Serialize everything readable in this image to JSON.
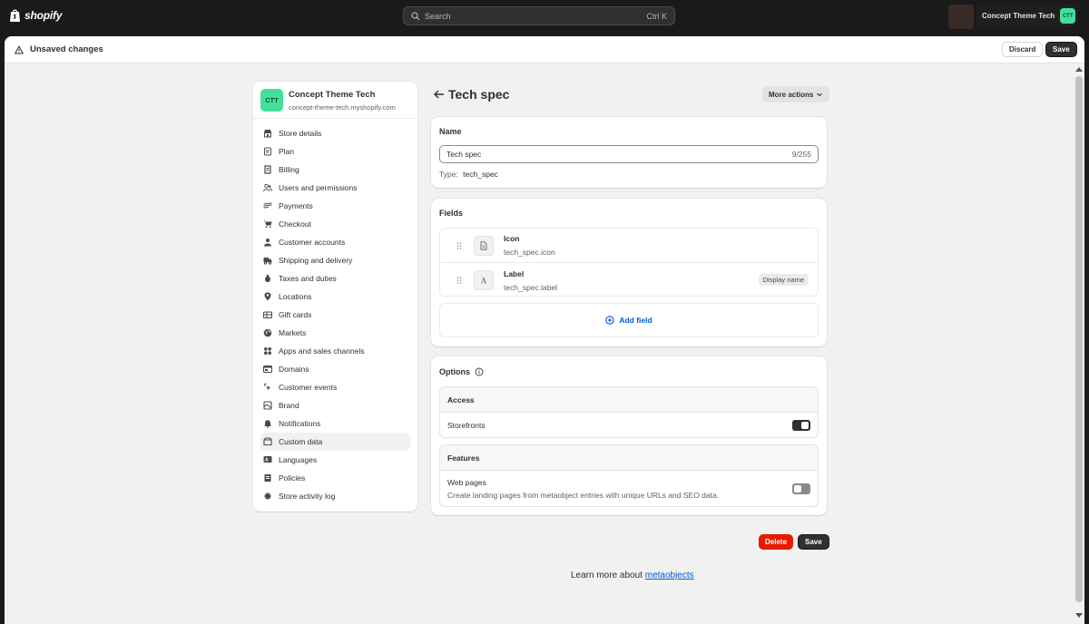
{
  "topbar": {
    "brand": "shopify",
    "search_placeholder": "Search",
    "search_shortcut": "Ctrl K",
    "store_name": "Concept Theme Tech",
    "store_initials": "CTT"
  },
  "save_bar": {
    "message": "Unsaved changes",
    "discard_label": "Discard",
    "save_label": "Save"
  },
  "settings_nav": {
    "store_name": "Concept Theme Tech",
    "store_domain": "concept-theme-tech.myshopify.com",
    "store_initials": "CTT",
    "items": [
      {
        "label": "Store details",
        "icon": "store-icon"
      },
      {
        "label": "Plan",
        "icon": "plan-icon"
      },
      {
        "label": "Billing",
        "icon": "billing-icon"
      },
      {
        "label": "Users and permissions",
        "icon": "users-icon"
      },
      {
        "label": "Payments",
        "icon": "payments-icon"
      },
      {
        "label": "Checkout",
        "icon": "cart-icon"
      },
      {
        "label": "Customer accounts",
        "icon": "person-icon"
      },
      {
        "label": "Shipping and delivery",
        "icon": "truck-icon"
      },
      {
        "label": "Taxes and duties",
        "icon": "tax-icon"
      },
      {
        "label": "Locations",
        "icon": "location-icon"
      },
      {
        "label": "Gift cards",
        "icon": "gift-card-icon"
      },
      {
        "label": "Markets",
        "icon": "globe-icon"
      },
      {
        "label": "Apps and sales channels",
        "icon": "apps-icon"
      },
      {
        "label": "Domains",
        "icon": "domain-icon"
      },
      {
        "label": "Customer events",
        "icon": "cursor-icon"
      },
      {
        "label": "Brand",
        "icon": "brand-icon"
      },
      {
        "label": "Notifications",
        "icon": "bell-icon"
      },
      {
        "label": "Custom data",
        "icon": "custom-data-icon",
        "active": true
      },
      {
        "label": "Languages",
        "icon": "language-icon"
      },
      {
        "label": "Policies",
        "icon": "policy-icon"
      },
      {
        "label": "Store activity log",
        "icon": "activity-icon"
      }
    ]
  },
  "page": {
    "title": "Tech spec",
    "more_actions_label": "More actions"
  },
  "name_card": {
    "title": "Name",
    "value": "Tech spec",
    "char_count": "9/255",
    "type_label": "Type:",
    "type_value": "tech_spec"
  },
  "fields_card": {
    "title": "Fields",
    "fields": [
      {
        "name": "Icon",
        "key": "tech_spec.icon",
        "icon": "file-icon",
        "badge": ""
      },
      {
        "name": "Label",
        "key": "tech_spec.label",
        "icon": "text-icon",
        "badge": "Display name"
      }
    ],
    "add_label": "Add field"
  },
  "options_card": {
    "title": "Options",
    "access": {
      "heading": "Access",
      "row_label": "Storefronts",
      "enabled": true
    },
    "features": {
      "heading": "Features",
      "row_label": "Web pages",
      "row_desc": "Create landing pages from metaobject entries with unique URLs and SEO data.",
      "enabled": false
    }
  },
  "footer": {
    "delete_label": "Delete",
    "save_label": "Save",
    "learn_text": "Learn more about",
    "learn_link": "metaobjects"
  },
  "colors": {
    "accent_green": "#44e09a",
    "link_blue": "#005bd3",
    "danger_red": "#e51c00"
  }
}
